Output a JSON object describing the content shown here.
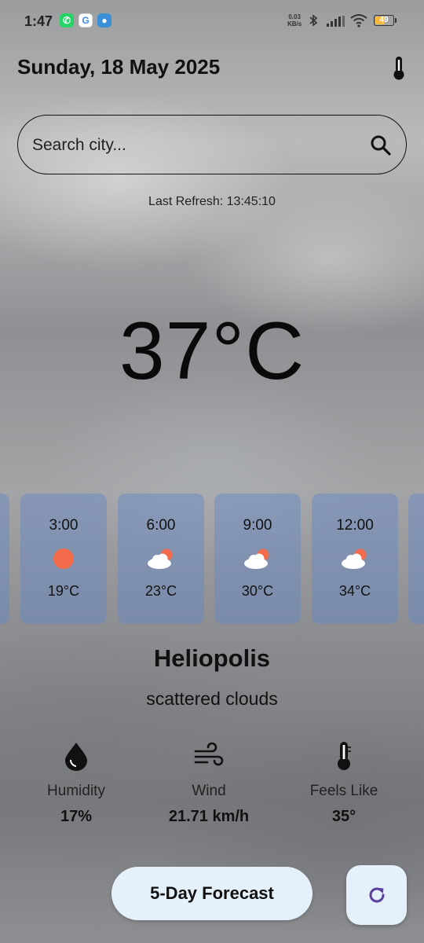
{
  "status_bar": {
    "time": "1:47",
    "net_speed_value": "0.03",
    "net_speed_unit": "KB/s",
    "battery_level": "49",
    "apps": [
      "whatsapp-icon",
      "google-icon",
      "app-icon"
    ]
  },
  "header": {
    "date": "Sunday, 18 May 2025",
    "unit_toggle_icon": "thermometer-icon"
  },
  "search": {
    "placeholder": "Search city...",
    "value": ""
  },
  "last_refresh": "Last Refresh: 13:45:10",
  "current": {
    "temperature": "37°C",
    "city": "Heliopolis",
    "condition": "scattered clouds"
  },
  "hourly": [
    {
      "time": "3:00",
      "icon": "sun-icon",
      "temp": "19°C"
    },
    {
      "time": "6:00",
      "icon": "partly-cloudy-icon",
      "temp": "23°C"
    },
    {
      "time": "9:00",
      "icon": "partly-cloudy-icon",
      "temp": "30°C"
    },
    {
      "time": "12:00",
      "icon": "partly-cloudy-icon",
      "temp": "34°C"
    }
  ],
  "stats": {
    "humidity": {
      "label": "Humidity",
      "value": "17%",
      "icon": "droplet-icon"
    },
    "wind": {
      "label": "Wind",
      "value": "21.71 km/h",
      "icon": "wind-icon"
    },
    "feels_like": {
      "label": "Feels Like",
      "value": "35°",
      "icon": "thermometer-icon"
    }
  },
  "actions": {
    "forecast_label": "5-Day Forecast",
    "refresh_icon": "refresh-icon"
  },
  "colors": {
    "card_bg": "#6487c8",
    "sun": "#f26b4a",
    "button_bg": "#e4f1fb",
    "refresh_icon": "#5b3fa0"
  }
}
